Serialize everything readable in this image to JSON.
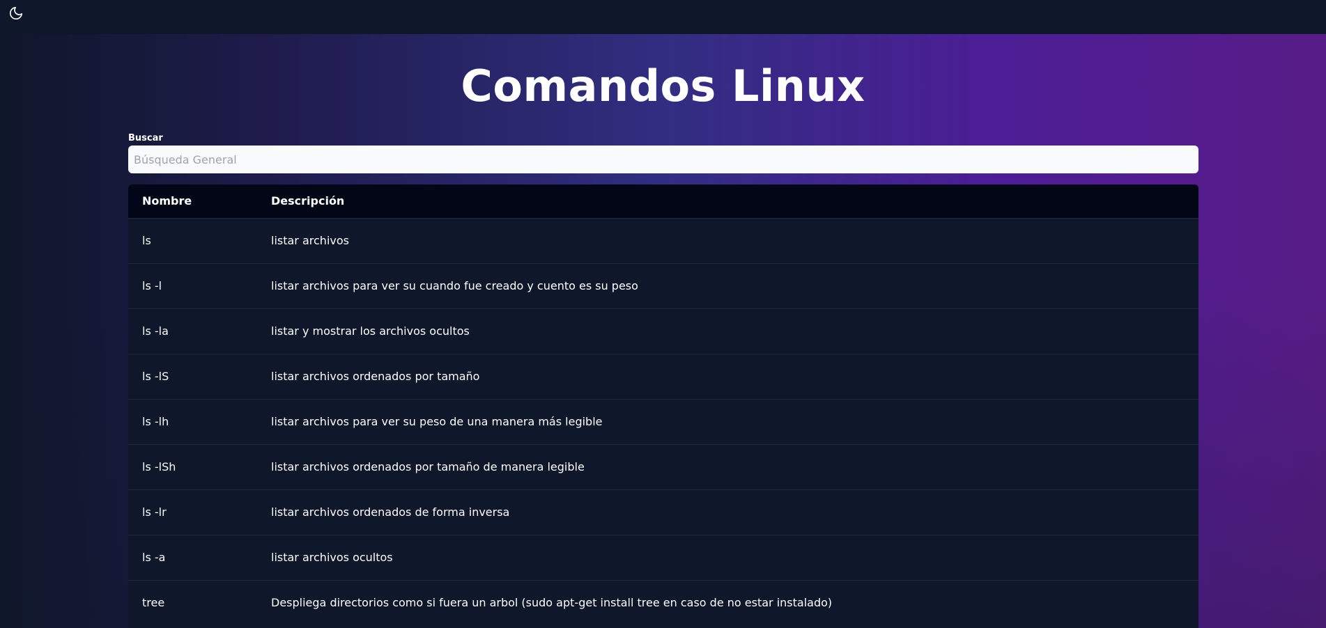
{
  "header": {
    "theme_icon": "moon-icon"
  },
  "page": {
    "title": "Comandos Linux"
  },
  "search": {
    "label": "Buscar",
    "placeholder": "Búsqueda General",
    "value": ""
  },
  "table": {
    "columns": [
      "Nombre",
      "Descripción"
    ],
    "rows": [
      {
        "name": "ls",
        "description": "listar archivos"
      },
      {
        "name": "ls -l",
        "description": "listar archivos para ver su cuando fue creado y cuento es su peso"
      },
      {
        "name": "ls -la",
        "description": "listar y mostrar los archivos ocultos"
      },
      {
        "name": "ls -lS",
        "description": "listar archivos ordenados por tamaño"
      },
      {
        "name": "ls -lh",
        "description": "listar archivos para ver su peso de una manera más legible"
      },
      {
        "name": "ls -lSh",
        "description": "listar archivos ordenados por tamaño de manera legible"
      },
      {
        "name": "ls -lr",
        "description": "listar archivos ordenados de forma inversa"
      },
      {
        "name": "ls -a",
        "description": "listar archivos ocultos"
      },
      {
        "name": "tree",
        "description": "Despliega directorios como si fuera un arbol (sudo apt-get install tree en caso de no estar instalado)"
      }
    ]
  },
  "colors": {
    "background": "#0f172a",
    "table_header": "#020617",
    "gradient_end": "#581c87"
  }
}
